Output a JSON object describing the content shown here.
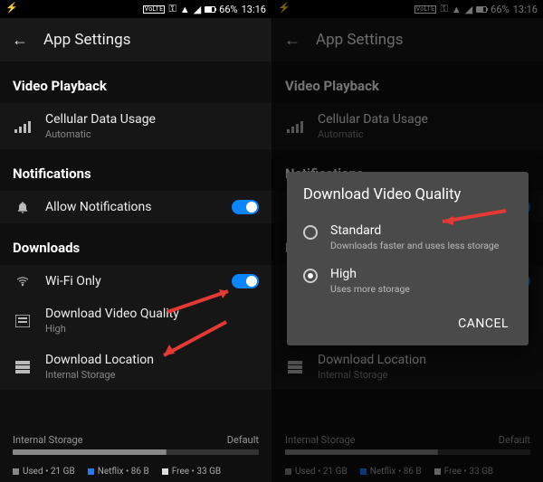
{
  "status": {
    "battery": "66%",
    "time": "13:16",
    "volte": "VoLTE"
  },
  "appbar": {
    "title": "App Settings"
  },
  "sections": {
    "video": {
      "title": "Video Playback",
      "cellular": {
        "label": "Cellular Data Usage",
        "value": "Automatic"
      }
    },
    "notifications": {
      "title": "Notifications",
      "allow": {
        "label": "Allow Notifications"
      }
    },
    "downloads": {
      "title": "Downloads",
      "wifi": {
        "label": "Wi-Fi Only"
      },
      "quality": {
        "label": "Download Video Quality",
        "value": "High"
      },
      "location": {
        "label": "Download Location",
        "value": "Internal Storage"
      }
    }
  },
  "storage": {
    "title": "Internal Storage",
    "default": "Default",
    "used": "Used • 21 GB",
    "netflix": "Netflix • 86 B",
    "free": "Free • 33 GB"
  },
  "dialog": {
    "title": "Download Video Quality",
    "options": [
      {
        "label": "Standard",
        "desc": "Downloads faster and uses less storage",
        "selected": false
      },
      {
        "label": "High",
        "desc": "Uses more storage",
        "selected": true
      }
    ],
    "cancel": "CANCEL"
  }
}
